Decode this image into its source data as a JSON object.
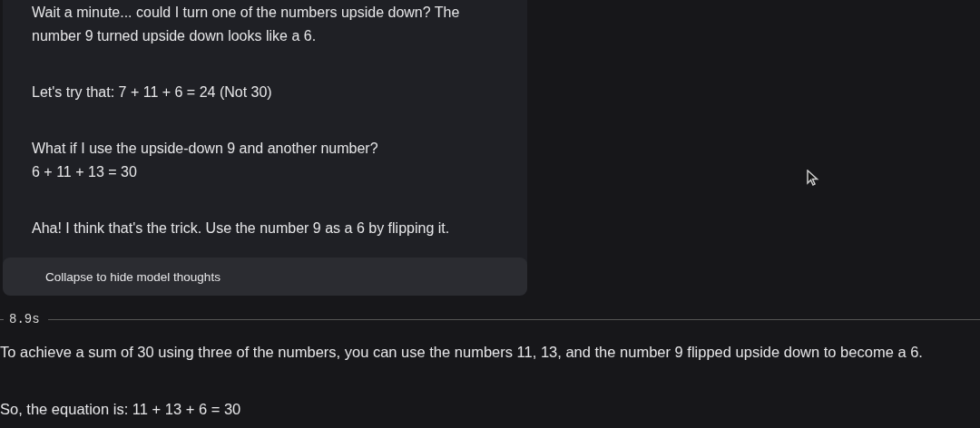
{
  "thoughts": {
    "paragraphs": [
      "Wait a minute... could I turn one of the numbers upside down? The number 9 turned upside down looks like a 6.",
      "Let's try that: 7 + 11 + 6 = 24 (Not 30)",
      "What if I use the upside-down 9 and another number?\n6 + 11 + 13 = 30",
      "Aha! I think that's the trick. Use the number 9 as a 6 by flipping it."
    ],
    "collapse_button": "Collapse to hide model thoughts"
  },
  "elapsed": "8.9s",
  "answer": {
    "paragraphs": [
      "To achieve a sum of 30 using three of the numbers, you can use the numbers 11, 13, and the number 9 flipped upside down to become a 6.",
      "So, the equation is: 11 + 13 + 6 = 30"
    ]
  }
}
